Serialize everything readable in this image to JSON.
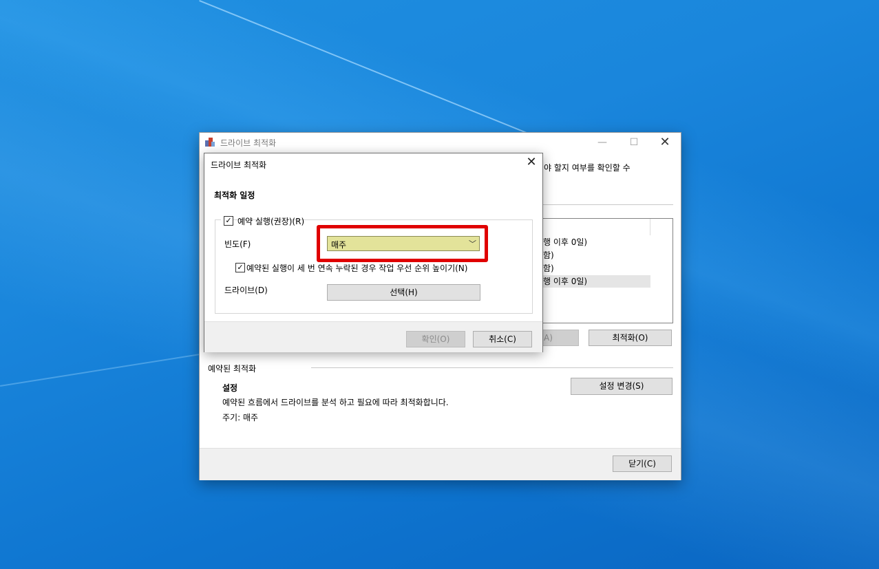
{
  "window": {
    "title": "드라이브 최적화",
    "description_fragment": "야 할지 여부를 확인할 수",
    "list_rows": [
      "행 이후 0일)",
      "함)",
      "함)",
      "행 이후 0일)"
    ],
    "analyze_fragment": "A)",
    "optimize_label": "최적화(O)",
    "scheduled_section": "예약된 최적화",
    "settings_heading": "설정",
    "change_settings_label": "설정 변경(S)",
    "schedule_desc": "예약된 흐름에서 드라이브를 분석 하고 필요에 따라 최적화합니다.",
    "frequency_line": "주기: 매주",
    "close_label": "닫기(C)"
  },
  "dialog": {
    "title": "드라이브 최적화",
    "heading": "최적화 일정",
    "run_on_schedule": "예약 실행(권장)(R)",
    "frequency_label": "빈도(F)",
    "frequency_value": "매주",
    "priority_option": "예약된 실행이 세 번 연속 누락된 경우 작업 우선 순위 높이기(N)",
    "drives_label": "드라이브(D)",
    "choose_label": "선택(H)",
    "ok_label": "확인(O)",
    "cancel_label": "취소(C)"
  },
  "colors": {
    "highlight_border": "#e00000",
    "select_fill": "#e3e39a",
    "desktop": "#1a86dc"
  }
}
